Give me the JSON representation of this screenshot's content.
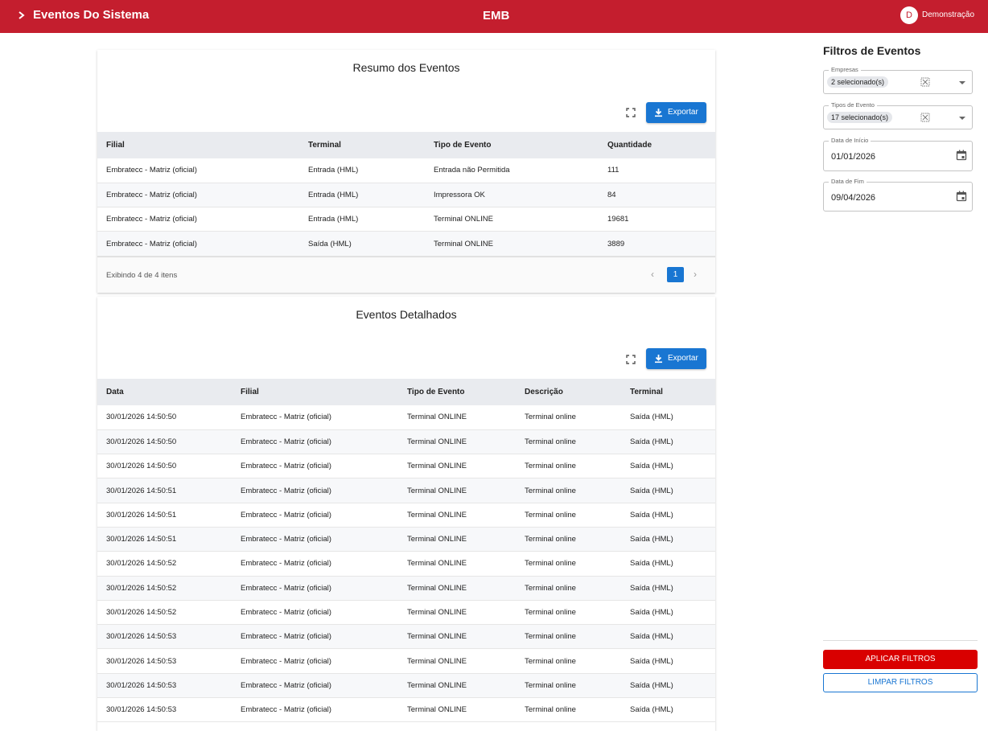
{
  "header": {
    "title": "Eventos Do Sistema",
    "brand": "EMB",
    "avatar_initial": "D",
    "user_name": "Demonstração",
    "bar_color": "#c41e2e"
  },
  "summary": {
    "title": "Resumo dos Eventos",
    "export_label": "Exportar",
    "columns": [
      "Filial",
      "Terminal",
      "Tipo de Evento",
      "Quantidade"
    ],
    "rows": [
      [
        "Embratecc - Matriz (oficial)",
        "Entrada (HML)",
        "Entrada não Permitida",
        "111"
      ],
      [
        "Embratecc - Matriz (oficial)",
        "Entrada (HML)",
        "Impressora OK",
        "84"
      ],
      [
        "Embratecc - Matriz (oficial)",
        "Entrada (HML)",
        "Terminal ONLINE",
        "19681"
      ],
      [
        "Embratecc - Matriz (oficial)",
        "Saída (HML)",
        "Terminal ONLINE",
        "3889"
      ]
    ],
    "pager": {
      "info": "Exibindo 4 de 4 itens",
      "current_page": "1",
      "prev": "‹",
      "next": "›"
    }
  },
  "detail": {
    "title": "Eventos Detalhados",
    "export_label": "Exportar",
    "columns": [
      "Data",
      "Filial",
      "Tipo de Evento",
      "Descrição",
      "Terminal"
    ],
    "rows": [
      [
        "30/01/2026 14:50:50",
        "Embratecc - Matriz (oficial)",
        "Terminal ONLINE",
        "Terminal online",
        "Saída (HML)"
      ],
      [
        "30/01/2026 14:50:50",
        "Embratecc - Matriz (oficial)",
        "Terminal ONLINE",
        "Terminal online",
        "Saída (HML)"
      ],
      [
        "30/01/2026 14:50:50",
        "Embratecc - Matriz (oficial)",
        "Terminal ONLINE",
        "Terminal online",
        "Saída (HML)"
      ],
      [
        "30/01/2026 14:50:51",
        "Embratecc - Matriz (oficial)",
        "Terminal ONLINE",
        "Terminal online",
        "Saída (HML)"
      ],
      [
        "30/01/2026 14:50:51",
        "Embratecc - Matriz (oficial)",
        "Terminal ONLINE",
        "Terminal online",
        "Saída (HML)"
      ],
      [
        "30/01/2026 14:50:51",
        "Embratecc - Matriz (oficial)",
        "Terminal ONLINE",
        "Terminal online",
        "Saída (HML)"
      ],
      [
        "30/01/2026 14:50:52",
        "Embratecc - Matriz (oficial)",
        "Terminal ONLINE",
        "Terminal online",
        "Saída (HML)"
      ],
      [
        "30/01/2026 14:50:52",
        "Embratecc - Matriz (oficial)",
        "Terminal ONLINE",
        "Terminal online",
        "Saída (HML)"
      ],
      [
        "30/01/2026 14:50:52",
        "Embratecc - Matriz (oficial)",
        "Terminal ONLINE",
        "Terminal online",
        "Saída (HML)"
      ],
      [
        "30/01/2026 14:50:53",
        "Embratecc - Matriz (oficial)",
        "Terminal ONLINE",
        "Terminal online",
        "Saída (HML)"
      ],
      [
        "30/01/2026 14:50:53",
        "Embratecc - Matriz (oficial)",
        "Terminal ONLINE",
        "Terminal online",
        "Saída (HML)"
      ],
      [
        "30/01/2026 14:50:53",
        "Embratecc - Matriz (oficial)",
        "Terminal ONLINE",
        "Terminal online",
        "Saída (HML)"
      ],
      [
        "30/01/2026 14:50:53",
        "Embratecc - Matriz (oficial)",
        "Terminal ONLINE",
        "Terminal online",
        "Saída (HML)"
      ]
    ]
  },
  "filters": {
    "title": "Filtros de Eventos",
    "empresas": {
      "label": "Empresas",
      "chip": "2 selecionado(s)"
    },
    "tipos": {
      "label": "Tipos de Evento",
      "chip": "17 selecionado(s)"
    },
    "data_inicio": {
      "label": "Data de Início",
      "value": "01/01/2026"
    },
    "data_fim": {
      "label": "Data de Fim",
      "value": "09/04/2026"
    },
    "apply_label": "APLICAR FILTROS",
    "clear_label": "LIMPAR FILTROS"
  },
  "colors": {
    "primary": "#1976d2",
    "apply": "#d90000"
  }
}
